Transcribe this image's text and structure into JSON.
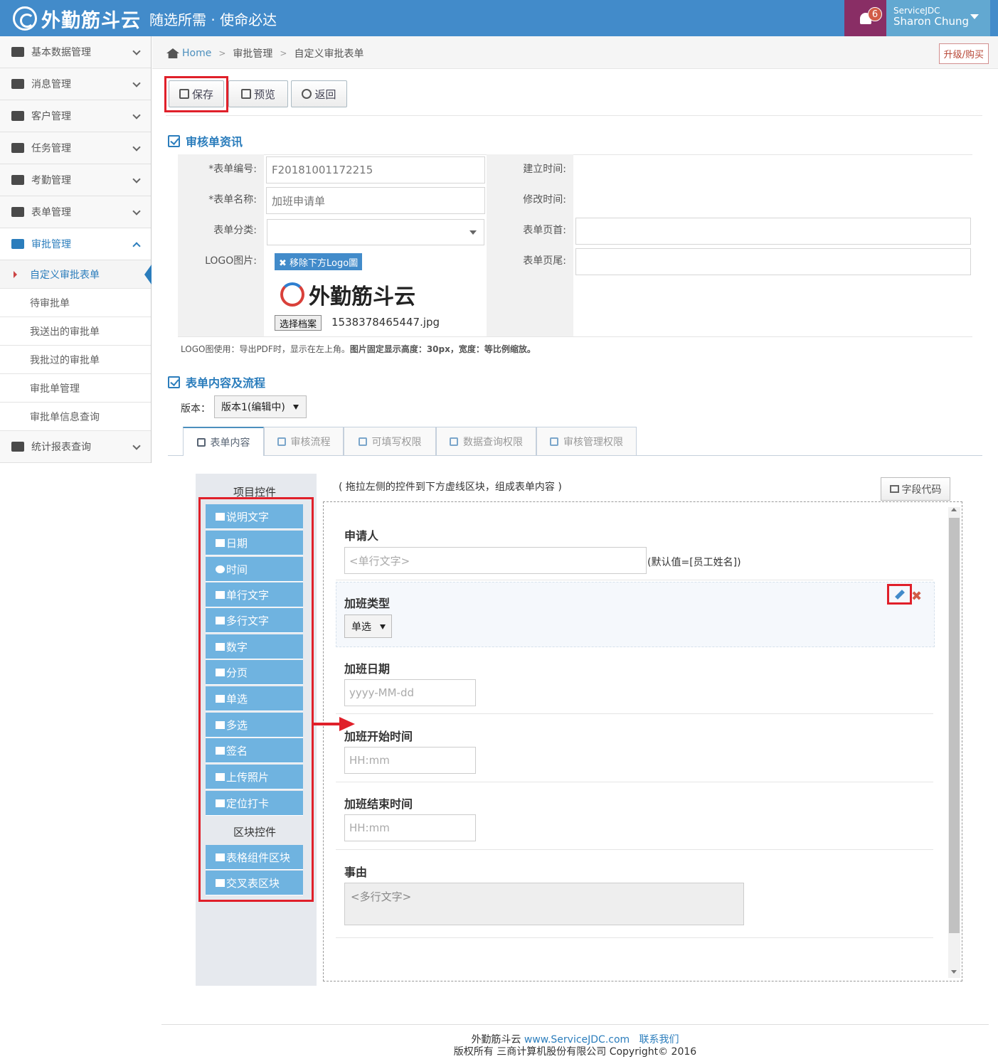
{
  "header": {
    "brand_name": "外勤筋斗云",
    "slogan": "随选所需 · 使命必达",
    "notification_count": "6",
    "company": "ServiceJDC",
    "user_name": "Sharon Chung"
  },
  "sidebar": {
    "items": [
      {
        "label": "基本数据管理",
        "icon": "list-icon"
      },
      {
        "label": "消息管理",
        "icon": "comments-icon"
      },
      {
        "label": "客户管理",
        "icon": "users-icon"
      },
      {
        "label": "任务管理",
        "icon": "tasks-icon"
      },
      {
        "label": "考勤管理",
        "icon": "edit-icon"
      },
      {
        "label": "表单管理",
        "icon": "file-icon"
      },
      {
        "label": "审批管理",
        "icon": "file-text-icon"
      }
    ],
    "subitems": [
      "自定义审批表单",
      "待审批单",
      "我送出的审批单",
      "我批过的审批单",
      "审批单管理",
      "审批单信息查询"
    ],
    "last_item": "统计报表查询"
  },
  "breadcrumb": {
    "home": "Home",
    "level1": "审批管理",
    "level2": "自定义审批表单"
  },
  "upgrade_label": "升级/购买",
  "toolbar": {
    "save": "保存",
    "preview": "预览",
    "back": "返回"
  },
  "section1": {
    "title": "审核单资讯",
    "form_no_label": "*表单编号:",
    "form_no_value": "F20181001172215",
    "form_name_label": "*表单名称:",
    "form_name_value": "加班申请单",
    "category_label": "表单分类:",
    "logo_label": "LOGO图片:",
    "remove_logo": "✖ 移除下方Logo圖",
    "logo_text": "外勤筋斗云",
    "choose_file": "选择档案",
    "file_name": "1538378465447.jpg",
    "created_label": "建立时间:",
    "modified_label": "修改时间:",
    "header_label": "表单页首:",
    "footer_label": "表单页尾:",
    "hint_prefix": "LOGO图使用：导出PDF时，显示在左上角。",
    "hint_bold": "图片固定显示高度：30px，宽度：等比例缩放。"
  },
  "section2": {
    "title": "表单内容及流程",
    "version_label": "版本：",
    "version_value": "版本1(编辑中)"
  },
  "tabs": [
    "表单内容",
    "审核流程",
    "可填写权限",
    "数据查询权限",
    "审核管理权限"
  ],
  "palette": {
    "items_title": "项目控件",
    "items": [
      "说明文字",
      "日期",
      "时间",
      "单行文字",
      "多行文字",
      "数字",
      "分页",
      "单选",
      "多选",
      "签名",
      "上传照片",
      "定位打卡"
    ],
    "blocks_title": "区块控件",
    "blocks": [
      "表格组件区块",
      "交叉表区块"
    ]
  },
  "canvas": {
    "hint": "( 拖拉左侧的控件到下方虚线区块，组成表单内容 )",
    "field_code": "字段代码",
    "fields": {
      "applicant_label": "申请人",
      "applicant_placeholder": "<单行文字>",
      "applicant_default": "(默认值=[员工姓名])",
      "type_label": "加班类型",
      "type_select": "单选",
      "date_label": "加班日期",
      "date_placeholder": "yyyy-MM-dd",
      "start_label": "加班开始时间",
      "start_placeholder": "HH:mm",
      "end_label": "加班结束时间",
      "end_placeholder": "HH:mm",
      "reason_label": "事由",
      "reason_placeholder": "<多行文字>"
    }
  },
  "footer": {
    "brand": "外勤筋斗云",
    "url": "www.ServiceJDC.com",
    "contact": "联系我们",
    "copyright": "版权所有 三商计算机股份有限公司 Copyright© 2016"
  },
  "colors": {
    "primary": "#428bca",
    "accent_red": "#e0202a",
    "palette_button": "#6fb3e0"
  }
}
